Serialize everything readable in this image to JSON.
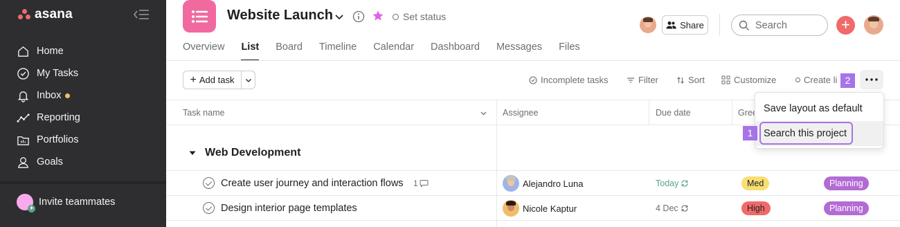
{
  "sidebar": {
    "logo": "asana",
    "items": [
      {
        "label": "Home",
        "icon": "home-icon"
      },
      {
        "label": "My Tasks",
        "icon": "check-circle-icon"
      },
      {
        "label": "Inbox",
        "icon": "bell-icon"
      },
      {
        "label": "Reporting",
        "icon": "trend-line-icon"
      },
      {
        "label": "Portfolios",
        "icon": "folder-chart-icon"
      },
      {
        "label": "Goals",
        "icon": "person-icon"
      }
    ],
    "invite_label": "Invite teammates"
  },
  "project": {
    "title": "Website Launch",
    "set_status": "Set status",
    "share": "Share",
    "search_placeholder": "Search"
  },
  "tabs": [
    "Overview",
    "List",
    "Board",
    "Timeline",
    "Calendar",
    "Dashboard",
    "Messages",
    "Files"
  ],
  "active_tab": "List",
  "toolbar": {
    "add_task": "Add task",
    "incomplete": "Incomplete tasks",
    "filter": "Filter",
    "sort": "Sort",
    "customize": "Customize",
    "create_link": "Create li"
  },
  "columns": {
    "task_name": "Task name",
    "assignee": "Assignee",
    "due_date": "Due date",
    "green": "Gree"
  },
  "section": "Web Development",
  "rows": [
    {
      "name": "Create user journey and interaction flows",
      "comments": "1",
      "assignee": "Alejandro Luna",
      "due": "Today",
      "priority": "Med",
      "status": "Planning"
    },
    {
      "name": "Design interior page templates",
      "comments": "",
      "assignee": "Nicole Kaptur",
      "due": "4 Dec",
      "priority": "High",
      "status": "Planning"
    }
  ],
  "menu": {
    "items": [
      "Save layout as default",
      "Search this project"
    ]
  },
  "badges": {
    "one": "1",
    "two": "2"
  },
  "colors": {
    "sidebar_bg": "#2e2e30",
    "brand": "#f06a6a",
    "project_icon": "#f06a9f",
    "due_today": "#5da283",
    "med_pill": "#f8df72",
    "high_pill": "#f06a6a",
    "planning_pill": "#b36bd4",
    "badge": "#a673e8"
  }
}
